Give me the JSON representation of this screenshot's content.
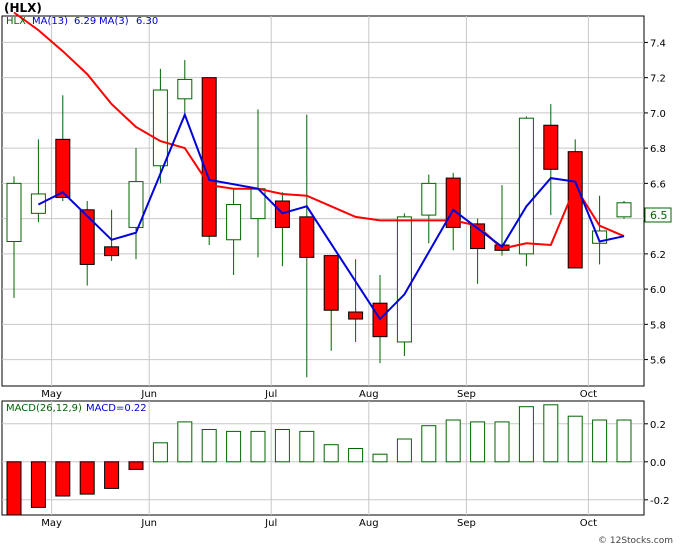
{
  "colors": {
    "up_fill": "#ffffff",
    "up_stroke": "#006400",
    "down_fill": "#ff0000",
    "wick": "#006400",
    "ma13": "#ff0000",
    "ma3": "#0000dd",
    "macd_pos_fill": "#ffffff",
    "macd_pos_stroke": "#006400",
    "macd_neg_fill": "#ff0000",
    "grid": "#c8c8c8",
    "axis": "#000000"
  },
  "legend": {
    "symbol": "HLX",
    "ma13_label": "MA(13)",
    "ma13_value": "6.29",
    "ma3_label": "MA(3)",
    "ma3_value": "6.30"
  },
  "title": "(HLX)",
  "last_price_label": "6.5",
  "macd_legend": {
    "label": "MACD(26,12,9)",
    "value_label": "MACD=0.22"
  },
  "watermark": "© 12Stocks.com",
  "chart_data": [
    {
      "type": "candlestick",
      "title": "(HLX)",
      "x_ticks": [
        "May",
        "Jun",
        "Jul",
        "Aug",
        "Sep",
        "Oct"
      ],
      "x_tick_week_index": [
        1,
        5,
        10,
        14,
        18,
        23
      ],
      "ylim": [
        5.45,
        7.55
      ],
      "y_ticks": [
        "7.4",
        "7.2",
        "7.0",
        "6.8",
        "6.6",
        "6.4",
        "6.2",
        "6.0",
        "5.8",
        "5.6"
      ],
      "y_tick_values": [
        7.4,
        7.2,
        7.0,
        6.8,
        6.6,
        6.4,
        6.2,
        6.0,
        5.8,
        5.6
      ],
      "grid": true,
      "candles": [
        {
          "o": 6.27,
          "h": 6.64,
          "l": 5.95,
          "c": 6.6
        },
        {
          "o": 6.43,
          "h": 6.85,
          "l": 6.38,
          "c": 6.54
        },
        {
          "o": 6.85,
          "h": 7.1,
          "l": 6.5,
          "c": 6.52
        },
        {
          "o": 6.45,
          "h": 6.5,
          "l": 6.02,
          "c": 6.14
        },
        {
          "o": 6.24,
          "h": 6.45,
          "l": 6.16,
          "c": 6.19
        },
        {
          "o": 6.35,
          "h": 6.8,
          "l": 6.17,
          "c": 6.61
        },
        {
          "o": 6.7,
          "h": 7.25,
          "l": 6.6,
          "c": 7.13
        },
        {
          "o": 7.08,
          "h": 7.3,
          "l": 7.0,
          "c": 7.19
        },
        {
          "o": 7.2,
          "h": 7.2,
          "l": 6.25,
          "c": 6.3
        },
        {
          "o": 6.28,
          "h": 6.57,
          "l": 6.08,
          "c": 6.48
        },
        {
          "o": 6.4,
          "h": 7.02,
          "l": 6.18,
          "c": 6.57
        },
        {
          "o": 6.5,
          "h": 6.55,
          "l": 6.13,
          "c": 6.35
        },
        {
          "o": 6.41,
          "h": 6.99,
          "l": 5.5,
          "c": 6.18
        },
        {
          "o": 6.19,
          "h": 6.19,
          "l": 5.65,
          "c": 5.88
        },
        {
          "o": 5.87,
          "h": 6.17,
          "l": 5.7,
          "c": 5.83
        },
        {
          "o": 5.92,
          "h": 6.08,
          "l": 5.58,
          "c": 5.73
        },
        {
          "o": 5.7,
          "h": 6.43,
          "l": 5.62,
          "c": 6.41
        },
        {
          "o": 6.42,
          "h": 6.65,
          "l": 6.26,
          "c": 6.6
        },
        {
          "o": 6.63,
          "h": 6.66,
          "l": 6.22,
          "c": 6.35
        },
        {
          "o": 6.37,
          "h": 6.4,
          "l": 6.03,
          "c": 6.23
        },
        {
          "o": 6.25,
          "h": 6.59,
          "l": 6.19,
          "c": 6.22
        },
        {
          "o": 6.2,
          "h": 6.98,
          "l": 6.13,
          "c": 6.97
        },
        {
          "o": 6.93,
          "h": 7.05,
          "l": 6.42,
          "c": 6.68
        },
        {
          "o": 6.78,
          "h": 6.85,
          "l": 6.12,
          "c": 6.12
        },
        {
          "o": 6.26,
          "h": 6.53,
          "l": 6.14,
          "c": 6.33
        },
        {
          "o": 6.41,
          "h": 6.5,
          "l": 6.4,
          "c": 6.49
        }
      ],
      "ma13": [
        {
          "i": 0,
          "v": 7.57
        },
        {
          "i": 1,
          "v": 7.47
        },
        {
          "i": 2,
          "v": 7.35
        },
        {
          "i": 3,
          "v": 7.22
        },
        {
          "i": 4,
          "v": 7.05
        },
        {
          "i": 5,
          "v": 6.92
        },
        {
          "i": 6,
          "v": 6.84
        },
        {
          "i": 7,
          "v": 6.8
        },
        {
          "i": 8,
          "v": 6.59
        },
        {
          "i": 9,
          "v": 6.57
        },
        {
          "i": 10,
          "v": 6.57
        },
        {
          "i": 11,
          "v": 6.54
        },
        {
          "i": 12,
          "v": 6.53
        },
        {
          "i": 13,
          "v": 6.47
        },
        {
          "i": 14,
          "v": 6.41
        },
        {
          "i": 15,
          "v": 6.39
        },
        {
          "i": 16,
          "v": 6.39
        },
        {
          "i": 17,
          "v": 6.39
        },
        {
          "i": 18,
          "v": 6.39
        },
        {
          "i": 19,
          "v": 6.36
        },
        {
          "i": 20,
          "v": 6.23
        },
        {
          "i": 21,
          "v": 6.26
        },
        {
          "i": 22,
          "v": 6.25
        },
        {
          "i": 23,
          "v": 6.58
        },
        {
          "i": 24,
          "v": 6.36
        },
        {
          "i": 25,
          "v": 6.3
        }
      ],
      "ma3": [
        {
          "i": 1,
          "v": 6.48
        },
        {
          "i": 2,
          "v": 6.55
        },
        {
          "i": 4,
          "v": 6.28
        },
        {
          "i": 5,
          "v": 6.32
        },
        {
          "i": 7,
          "v": 6.99
        },
        {
          "i": 8,
          "v": 6.62
        },
        {
          "i": 10,
          "v": 6.57
        },
        {
          "i": 11,
          "v": 6.43
        },
        {
          "i": 12,
          "v": 6.47
        },
        {
          "i": 15,
          "v": 5.83
        },
        {
          "i": 16,
          "v": 5.97
        },
        {
          "i": 18,
          "v": 6.45
        },
        {
          "i": 20,
          "v": 6.24
        },
        {
          "i": 21,
          "v": 6.47
        },
        {
          "i": 22,
          "v": 6.63
        },
        {
          "i": 23,
          "v": 6.61
        },
        {
          "i": 24,
          "v": 6.27
        },
        {
          "i": 25,
          "v": 6.3
        }
      ]
    },
    {
      "type": "bar",
      "title": "MACD(26,12,9)",
      "x_ticks": [
        "May",
        "Jun",
        "Jul",
        "Aug",
        "Sep",
        "Oct"
      ],
      "ylim": [
        -0.28,
        0.32
      ],
      "y_ticks": [
        "0.2",
        "0.0",
        "-0.2"
      ],
      "y_tick_values": [
        0.2,
        0.0,
        -0.2
      ],
      "values": [
        -0.28,
        -0.24,
        -0.18,
        -0.17,
        -0.14,
        -0.04,
        0.1,
        0.21,
        0.17,
        0.16,
        0.16,
        0.17,
        0.16,
        0.09,
        0.07,
        0.04,
        0.12,
        0.19,
        0.22,
        0.21,
        0.21,
        0.29,
        0.3,
        0.24,
        0.22,
        0.22
      ]
    }
  ]
}
